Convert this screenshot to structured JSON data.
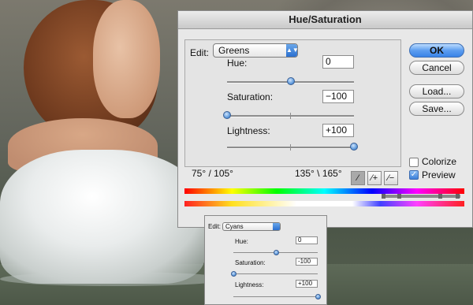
{
  "window": {
    "title": "Hue/Saturation"
  },
  "edit": {
    "label": "Edit:",
    "value": "Greens"
  },
  "sliders": [
    {
      "label": "Hue:",
      "value": "0",
      "level": 0.5
    },
    {
      "label": "Saturation:",
      "value": "−100",
      "level": 0.0
    },
    {
      "label": "Lightness:",
      "value": "+100",
      "level": 1.0
    }
  ],
  "buttons": {
    "ok": "OK",
    "cancel": "Cancel",
    "load": "Load...",
    "save": "Save..."
  },
  "options": {
    "colorize": {
      "label": "Colorize",
      "checked": false
    },
    "preview": {
      "label": "Preview",
      "checked": true
    }
  },
  "ranges": {
    "left": "75° / 105°",
    "right": "135° \\ 165°"
  },
  "eyedroppers": [
    "eyedropper-icon",
    "eyedropper-plus-icon",
    "eyedropper-minus-icon"
  ],
  "second_dialog": {
    "edit_label": "Edit:",
    "edit_value": "Cyans",
    "sliders": [
      {
        "label": "Hue:",
        "value": "0",
        "level": 0.5
      },
      {
        "label": "Saturation:",
        "value": "-100",
        "level": 0.0
      },
      {
        "label": "Lightness:",
        "value": "+100",
        "level": 1.0
      }
    ]
  },
  "colors": {
    "accent": "#3a83e8",
    "dialog_bg": "#e8e8e8"
  }
}
